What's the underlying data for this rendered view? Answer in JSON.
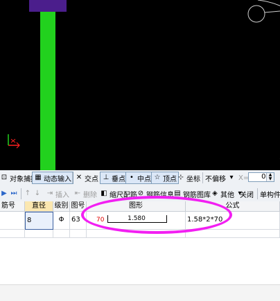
{
  "snap_toolbar": {
    "object_snap": "对象捕捉",
    "dynamic_input": "动态输入",
    "intersection": "交点",
    "perpendicular": "垂点",
    "midpoint": "中点",
    "vertex": "顶点",
    "coordinates": "坐标",
    "offset_mode": "不偏移",
    "x_label": "X=",
    "x_value": "0"
  },
  "edit_toolbar": {
    "insert": "插入",
    "delete": "删除",
    "scale_rebar": "缩尺配筋",
    "rebar_info": "钢筋信息",
    "rebar_library": "钢筋图库",
    "other": "其他",
    "close": "关闭",
    "single_component": "单构件"
  },
  "table": {
    "columns": [
      "筋号",
      "直径(mm)",
      "级别",
      "图号",
      "图形",
      "公式"
    ],
    "row": {
      "bar_no": "",
      "diameter": "8",
      "grade": "Φ",
      "figure_no": "63",
      "hook": "70",
      "length": "1.580",
      "formula": "1.58*2*70"
    }
  },
  "colors": {
    "canvas": "#000000",
    "column": "#22d11e",
    "purple_block": "#4b1e8c",
    "highlight_ellipse": "#f21ff2",
    "hook_text": "#e00000"
  }
}
